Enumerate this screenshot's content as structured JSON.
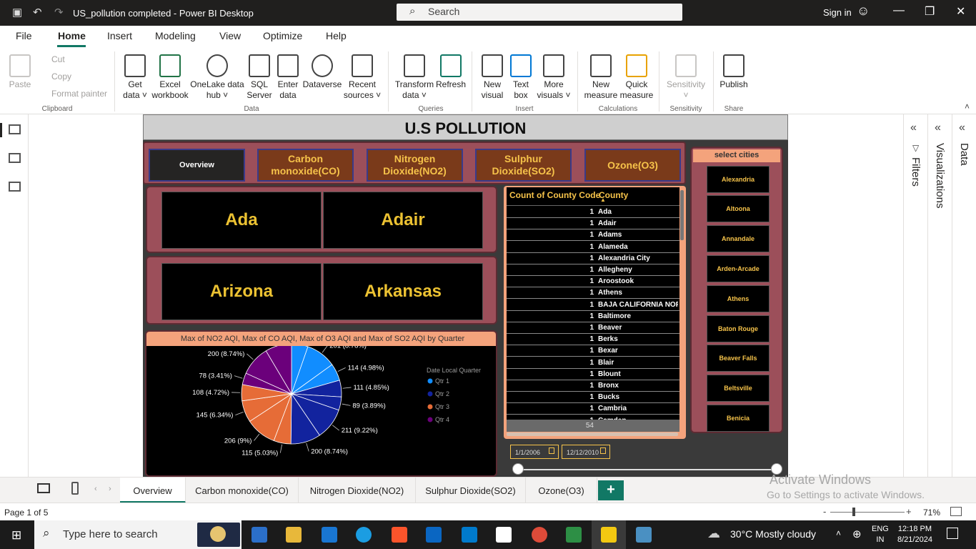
{
  "window": {
    "title": "US_pollution completed - Power BI Desktop",
    "search_placeholder": "Search",
    "signin": "Sign in"
  },
  "menu": [
    "File",
    "Home",
    "Insert",
    "Modeling",
    "View",
    "Optimize",
    "Help"
  ],
  "ribbon": {
    "clipboard": {
      "paste": "Paste",
      "cut": "Cut",
      "copy": "Copy",
      "format_painter": "Format painter",
      "group": "Clipboard"
    },
    "data": {
      "get_data": "Get\ndata ˅",
      "excel": "Excel\nworkbook",
      "onelake": "OneLake data\nhub ˅",
      "sql": "SQL\nServer",
      "enter": "Enter\ndata",
      "dataverse": "Dataverse",
      "recent": "Recent\nsources ˅",
      "group": "Data"
    },
    "queries": {
      "transform": "Transform\ndata ˅",
      "refresh": "Refresh",
      "group": "Queries"
    },
    "insert": {
      "new_visual": "New\nvisual",
      "text_box": "Text\nbox",
      "more_visuals": "More\nvisuals ˅",
      "group": "Insert"
    },
    "calculations": {
      "new_measure": "New\nmeasure",
      "quick_measure": "Quick\nmeasure",
      "group": "Calculations"
    },
    "sensitivity": {
      "label": "Sensitivity\n˅",
      "group": "Sensitivity"
    },
    "share": {
      "publish": "Publish",
      "group": "Share"
    }
  },
  "report": {
    "title": "U.S POLLUTION",
    "nav_buttons": [
      "Overview",
      "Carbon monoxide(CO)",
      "Nitrogen Dioxide(NO2)",
      "Sulphur Dioxide(SO2)",
      "Ozone(O3)"
    ],
    "kpis": [
      "Ada",
      "Adair",
      "Arizona",
      "Arkansas"
    ],
    "pie_title": "Max of NO2 AQI, Max of CO AQI, Max of O3 AQI and Max of SO2 AQI by Quarter",
    "legend_title": "Date Local Quarter",
    "legend": [
      {
        "label": "Qtr 1",
        "color": "#118dff"
      },
      {
        "label": "Qtr 2",
        "color": "#12239e"
      },
      {
        "label": "Qtr 3",
        "color": "#e66c37"
      },
      {
        "label": "Qtr 4",
        "color": "#6b007b"
      }
    ],
    "table": {
      "headers": [
        "Count of County Code",
        "County"
      ],
      "rows": [
        [
          "1",
          "Ada"
        ],
        [
          "1",
          "Adair"
        ],
        [
          "1",
          "Adams"
        ],
        [
          "1",
          "Alameda"
        ],
        [
          "1",
          "Alexandria City"
        ],
        [
          "1",
          "Allegheny"
        ],
        [
          "1",
          "Aroostook"
        ],
        [
          "1",
          "Athens"
        ],
        [
          "1",
          "BAJA CALIFORNIA NORTE"
        ],
        [
          "1",
          "Baltimore"
        ],
        [
          "1",
          "Beaver"
        ],
        [
          "1",
          "Berks"
        ],
        [
          "1",
          "Bexar"
        ],
        [
          "1",
          "Blair"
        ],
        [
          "1",
          "Blount"
        ],
        [
          "1",
          "Bronx"
        ],
        [
          "1",
          "Bucks"
        ],
        [
          "1",
          "Cambria"
        ],
        [
          "1",
          "Camden"
        ]
      ],
      "total": "54"
    },
    "cities_title": "select cities",
    "cities": [
      "Alexandria",
      "Altoona",
      "Annandale",
      "Arden-Arcade",
      "Athens",
      "Baton Rouge",
      "Beaver Falls",
      "Beltsville",
      "Benicia"
    ],
    "date_start": "1/1/2006",
    "date_end": "12/12/2010"
  },
  "chart_data": {
    "type": "pie",
    "title": "Max of NO2 AQI, Max of CO AQI, Max of O3 AQI and Max of SO2 AQI by Quarter",
    "legend_title": "Date Local Quarter",
    "slices": [
      {
        "value": 110,
        "label": "110 (4.81%)",
        "quarter": "Qtr 1"
      },
      {
        "value": 201,
        "label": "201 (8.78%)",
        "quarter": "Qtr 1"
      },
      {
        "value": 114,
        "label": "114 (4.98%)",
        "quarter": "Qtr 1"
      },
      {
        "value": 111,
        "label": "111 (4.85%)",
        "quarter": "Qtr 2"
      },
      {
        "value": 89,
        "label": "89 (3.89%)",
        "quarter": "Qtr 2"
      },
      {
        "value": 211,
        "label": "211 (9.22%)",
        "quarter": "Qtr 2"
      },
      {
        "value": 200,
        "label": "200 (8.74%)",
        "quarter": "Qtr 2"
      },
      {
        "value": 115,
        "label": "115 (5.03%)",
        "quarter": "Qtr 3"
      },
      {
        "value": 206,
        "label": "206 (9%)",
        "quarter": "Qtr 3"
      },
      {
        "value": 145,
        "label": "145 (6.34%)",
        "quarter": "Qtr 3"
      },
      {
        "value": 108,
        "label": "108 (4.72%)",
        "quarter": "Qtr 3"
      },
      {
        "value": 78,
        "label": "78 (3.41%)",
        "quarter": "Qtr 4"
      },
      {
        "value": 200,
        "label": "200 (8.74%)",
        "quarter": "Qtr 4"
      },
      {
        "value": 176,
        "label": "176 (7.69%)",
        "quarter": "Qtr 4"
      }
    ]
  },
  "panes": {
    "filters": "Filters",
    "visualizations": "Visualizations",
    "data": "Data"
  },
  "page_tabs": [
    "Overview",
    "Carbon monoxide(CO)",
    "Nitrogen Dioxide(NO2)",
    "Sulphur Dioxide(SO2)",
    "Ozone(O3)"
  ],
  "add_page": "+",
  "watermark": {
    "line1": "Activate Windows",
    "line2": "Go to Settings to activate Windows."
  },
  "status": {
    "page": "Page 1 of 5",
    "zoom": "71%"
  },
  "taskbar": {
    "search": "Type here to search",
    "weather": "30°C  Mostly cloudy",
    "lang": "ENG\nIN",
    "time": "12:18 PM",
    "date": "8/21/2024"
  }
}
